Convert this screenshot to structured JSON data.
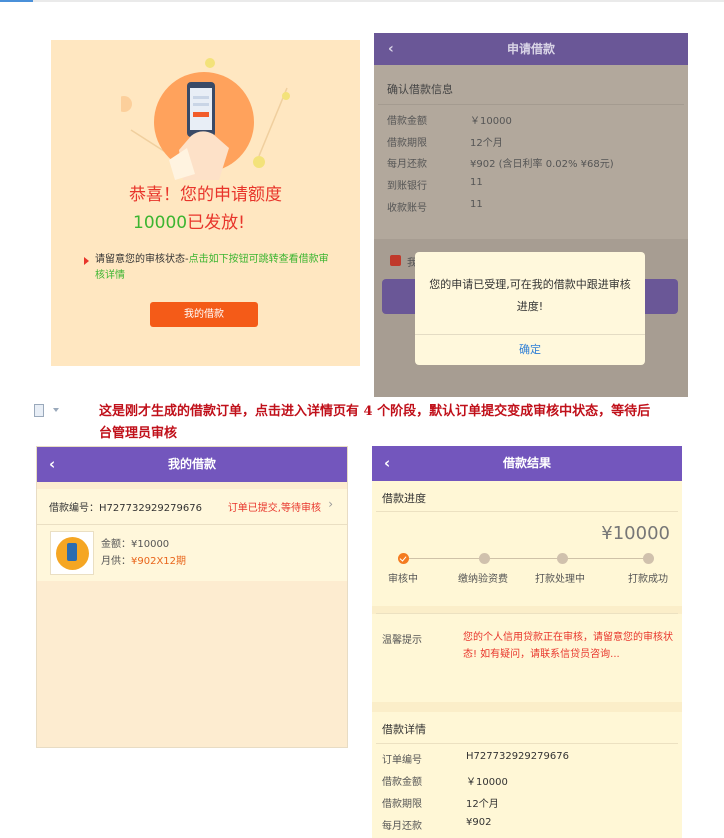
{
  "panel1": {
    "congrats": "恭喜！您的申请额度",
    "amount": "10000",
    "released": "已发放!",
    "tip_prefix": "请留意您的审核状态-",
    "tip_link": "点击如下按钮可跳转查看借款审核详情",
    "button": "我的借款"
  },
  "panel2": {
    "back": "‹",
    "title": "申请借款",
    "section": "确认借款信息",
    "rows": [
      {
        "label": "借款金额",
        "value": "￥10000"
      },
      {
        "label": "借款期限",
        "value": "12个月"
      },
      {
        "label": "每月还款",
        "value": "¥902  (含日利率 0.02% ¥68元)"
      },
      {
        "label": "到账银行",
        "value": "11"
      },
      {
        "label": "收款账号",
        "value": "11"
      }
    ],
    "checkbox_label": "我",
    "dialog_message": "您的申请已受理,可在我的借款中跟进审核进度!",
    "dialog_ok": "确定"
  },
  "caption": "这是刚才生成的借款订单，点击进入详情页有 4 个阶段，默认订单提交变成审核中状态，等待后台管理员审核",
  "panel3": {
    "back": "‹",
    "title": "我的借款",
    "order_id": "借款编号：H727732929279676",
    "status": "订单已提交,等待审核",
    "chevron": "›",
    "amount": "金额：¥10000",
    "monthly_label": "月供：",
    "monthly_value": "¥902X12期"
  },
  "panel4": {
    "back": "‹",
    "title": "借款结果",
    "progress_title": "借款进度",
    "big_amount": "¥10000",
    "steps": [
      "审核中",
      "缴纳验资费",
      "打款处理中",
      "打款成功"
    ],
    "tip_label": "温馨提示",
    "tip_text": "您的个人信用贷款正在审核，请留意您的审核状态! 如有疑问，请联系信贷员咨询...",
    "detail_title": "借款详情",
    "details": [
      {
        "label": "订单编号",
        "value": "H727732929279676"
      },
      {
        "label": "借款金额",
        "value": "￥10000"
      },
      {
        "label": "借款期限",
        "value": "12个月"
      },
      {
        "label": "每月还款",
        "value": "¥902"
      }
    ]
  }
}
